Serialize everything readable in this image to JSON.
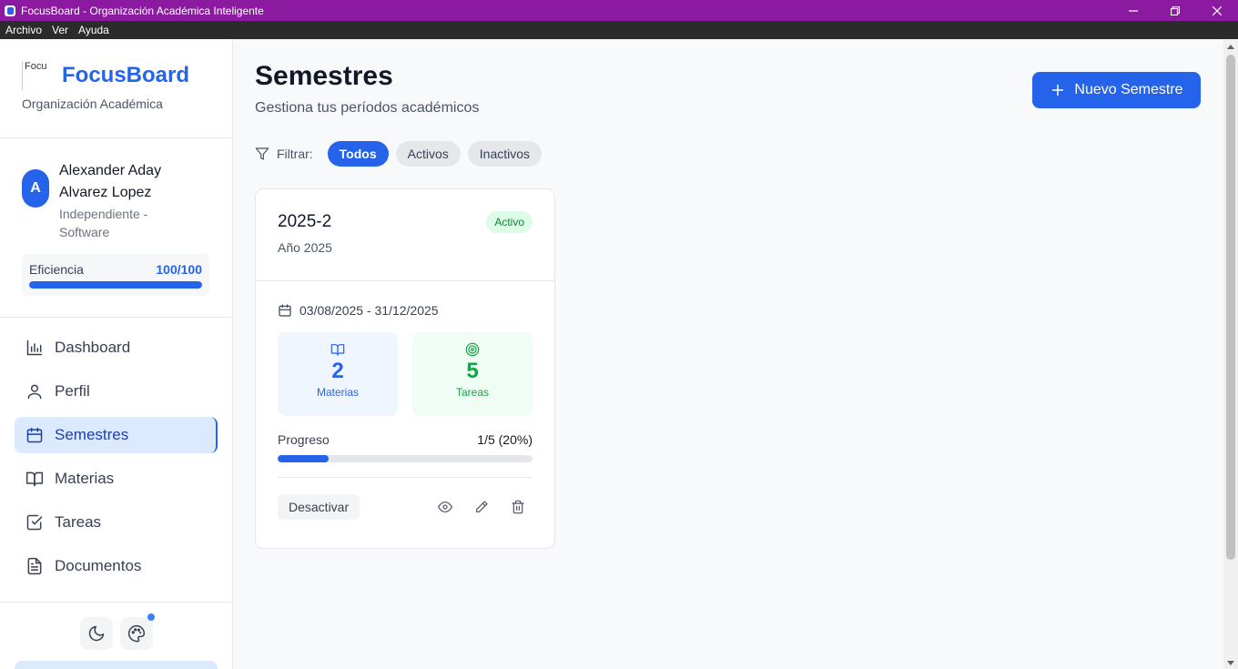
{
  "window": {
    "title": "FocusBoard - Organización Académica Inteligente",
    "menu": [
      "Archivo",
      "Ver",
      "Ayuda"
    ]
  },
  "sidebar": {
    "brand": {
      "name": "FocusBoard",
      "subtitle": "Organización Académica",
      "logo_alt": "Focu"
    },
    "user": {
      "initial": "A",
      "name": "Alexander Aday Alvarez Lopez",
      "role": "Independiente - Software",
      "efficiency_label": "Eficiencia",
      "efficiency_value": "100/100",
      "efficiency_fraction": 1.0
    },
    "nav": [
      {
        "label": "Dashboard",
        "icon": "bar-chart-icon",
        "active": false
      },
      {
        "label": "Perfil",
        "icon": "user-icon",
        "active": false
      },
      {
        "label": "Semestres",
        "icon": "calendar-icon",
        "active": true
      },
      {
        "label": "Materias",
        "icon": "book-open-icon",
        "active": false
      },
      {
        "label": "Tareas",
        "icon": "check-square-icon",
        "active": false
      },
      {
        "label": "Documentos",
        "icon": "file-text-icon",
        "active": false
      }
    ],
    "footer_icons": [
      "moon-icon",
      "palette-icon"
    ]
  },
  "main": {
    "title": "Semestres",
    "subtitle": "Gestiona tus períodos académicos",
    "new_button": "Nuevo Semestre",
    "filter": {
      "label": "Filtrar:",
      "options": [
        "Todos",
        "Activos",
        "Inactivos"
      ],
      "selected": "Todos"
    },
    "semesters": [
      {
        "name": "2025-2",
        "year": "Año 2025",
        "status": "Activo",
        "dates": "03/08/2025 - 31/12/2025",
        "subjects_count": "2",
        "subjects_label": "Materias",
        "tasks_count": "5",
        "tasks_label": "Tareas",
        "progress_label": "Progreso",
        "progress_text": "1/5 (20%)",
        "progress_fraction": 0.2,
        "deactivate_label": "Desactivar"
      }
    ]
  },
  "colors": {
    "titlebar": "#8b1aa0",
    "accent": "#2563eb",
    "active_badge": "#dcfce7"
  }
}
